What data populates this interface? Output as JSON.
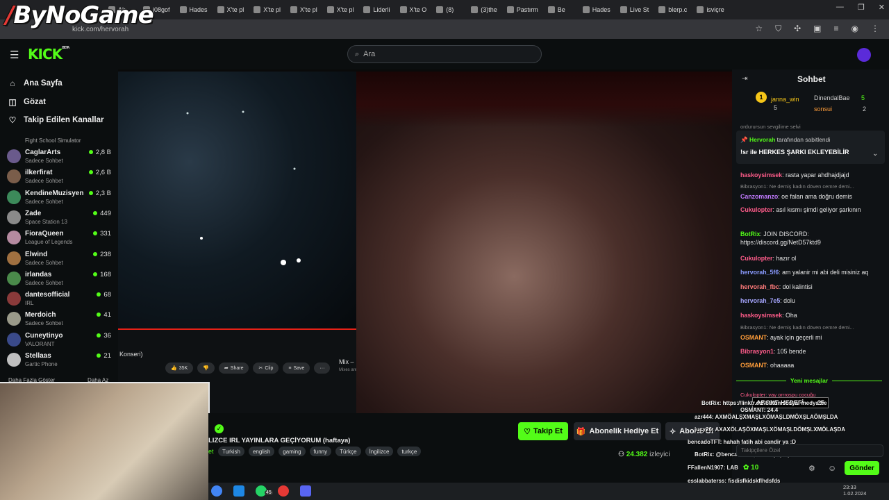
{
  "browser": {
    "tabs": [
      "Ak",
      "j08gof",
      "Hades",
      "X'te pl",
      "X'te pl",
      "X'te pl",
      "X'te pl",
      "Liderli",
      "X'te O",
      "(8)",
      "(3)the",
      "Pastırm",
      "Be",
      "Hades",
      "Live St",
      "blerp.c",
      "isviçre"
    ],
    "tab_prefix": "X'te O",
    "url": "kick.com/hervorah"
  },
  "watermark": {
    "slash": "/",
    "text": "ByNoGame"
  },
  "kick": {
    "logo": "KICK",
    "logo_sup": "BETA",
    "search_placeholder": "Ara"
  },
  "sidebar": {
    "nav": [
      {
        "label": "Ana Sayfa",
        "icon": "home-icon",
        "glyph": "⌂"
      },
      {
        "label": "Gözat",
        "icon": "browse-icon",
        "glyph": "◫"
      },
      {
        "label": "Takip Edilen Kanallar",
        "icon": "heart-icon",
        "glyph": "♡"
      }
    ],
    "partial_category": "Fight School Simulator",
    "channels": [
      {
        "name": "CaglarArts",
        "category": "Sadece Sohbet",
        "viewers": "2,8 B",
        "color": "#6a5a8c"
      },
      {
        "name": "ilkerfirat",
        "category": "Sadece Sohbet",
        "viewers": "2,6 B",
        "color": "#7a5d4a"
      },
      {
        "name": "KendineMuzisyen",
        "category": "Sadece Sohbet",
        "viewers": "2,3 B",
        "color": "#3c8a5a"
      },
      {
        "name": "Zade",
        "category": "Space Station 13",
        "viewers": "449",
        "color": "#8a8a8a"
      },
      {
        "name": "FioraQueen",
        "category": "League of Legends",
        "viewers": "331",
        "color": "#b58aa0"
      },
      {
        "name": "Elwind",
        "category": "Sadece Sohbet",
        "viewers": "238",
        "color": "#a07040"
      },
      {
        "name": "irlandas",
        "category": "Sadece Sohbet",
        "viewers": "168",
        "color": "#4a8a4a"
      },
      {
        "name": "dantesofficial",
        "category": "IRL",
        "viewers": "68",
        "color": "#8a3a3a"
      },
      {
        "name": "Merdoich",
        "category": "Sadece Sohbet",
        "viewers": "41",
        "color": "#9a9a8a"
      },
      {
        "name": "Cuneytinyo",
        "category": "VALORANT",
        "viewers": "36",
        "color": "#3a4a8a"
      },
      {
        "name": "Stellaas",
        "category": "Gartic Phone",
        "viewers": "21",
        "color": "#c0c0c0"
      }
    ],
    "show_more": "Daha Fazla Göster",
    "show_less": "Daha Az"
  },
  "video": {
    "yt_title_fragment": "Konseri)",
    "yt_actions": [
      "35K",
      "",
      "Share",
      "Clip",
      "Save",
      "···"
    ],
    "mix_label": "Mix –",
    "mix_sub": "Mixes are"
  },
  "channel": {
    "stream_title": "LIZCE IRL YAYINLARA GEÇİYORUM (haftaya)",
    "lang_fragment": "et",
    "tags": [
      "Turkish",
      "english",
      "gaming",
      "funny",
      "Türkçe",
      "İngilizce",
      "turkçe"
    ],
    "follow_label": "Takip Et",
    "gift_label": "Abonelik Hediye Et",
    "subscribe_label": "Abone Ol",
    "viewers": "24.382",
    "viewers_label": "izleyici"
  },
  "chat": {
    "title": "Sohbet",
    "leaderboard": [
      {
        "rank": "1",
        "name": "janna_win",
        "count": "5"
      },
      {
        "name": "DinendalBae",
        "count": "5"
      },
      {
        "name": "sonsui",
        "count": "2"
      }
    ],
    "partial_line": "ordurursun sevgilime selvi",
    "pinned_by_user": "Hervorah",
    "pinned_by_text": "tarafından sabitlendi",
    "pinned_text": "!sr ile HERKES ŞARKI EKLEYEBİLİR",
    "messages": [
      {
        "user": "haskoysimsek",
        "text": ": rasta yapar ahdhajdjajd",
        "color": "#ff5c8a"
      },
      {
        "reply": "Bibrasyon1: Ne demiş kadın döven cemre demi..."
      },
      {
        "user": "Canzomanzo",
        "text": ": oe falan ama doğru demis",
        "color": "#c17bff"
      },
      {
        "user": "Cukulopter",
        "text": ": asıl kısmı şimdi geliyor şarkının",
        "color": "#ff5c8a"
      },
      {
        "user": "BotRix",
        "text": ": JOIN DISCORD: https://discord.gg/NetD57ktd9",
        "color": "#53fc18"
      },
      {
        "user": "Cukulopter",
        "text": ": hazır ol",
        "color": "#ff5c8a"
      },
      {
        "user": "hervorah_5f6",
        "text": ": am yalanir mi abi deli misiniz aq",
        "color": "#8a9bff"
      },
      {
        "user": "hervorah_fbc",
        "text": ": dol kalintisi",
        "color": "#ff7b7b"
      },
      {
        "user": "hervorah_7e5",
        "text": ": dolu",
        "color": "#a6a6ff"
      },
      {
        "user": "haskoysimsek",
        "text": ": Oha",
        "color": "#ff5c8a"
      },
      {
        "reply": "Bibrasyon1: Ne demiş kadın döven cemre demi..."
      },
      {
        "user": "OSMANT",
        "text": ": ayak için geçerli mi",
        "color": "#ff9d3a"
      },
      {
        "user": "Bibrasyon1",
        "text": ": 105 bende",
        "color": "#ff5c8a"
      },
      {
        "user": "OSMANT",
        "text": ": ohaaaaa",
        "color": "#ff9d3a"
      }
    ],
    "new_messages": "Yeni mesajlar",
    "partial_after": "Cukulopter: vay orrrospu cocuğu",
    "input_placeholder": "Takipçilere Özel",
    "points": "10",
    "send_label": "Gönder"
  },
  "overlay": {
    "goal_label": "ABONE HEDEFİ",
    "goal_value": "25",
    "lines": [
      "BotRix: https://linktr.ee/ bütün sosyal medya he",
      "OSMANT: 24.4",
      "azr444: AXMÖALŞXMAŞLXÖMAŞLDMÖXŞLAÖMŞLDA",
      "jucy26: AXAXÖLAŞÖXMAŞLXÖMAŞLDÖMŞLXMÖLAŞDA",
      "bencadoTFT: hahah fatih abi candir ya :D",
      "BotRix: @bencadoTFT, 2. seviyeye yükseldin",
      "FFallenN1907: LAB",
      "esslabbaterss: fjsdjsfkjdskflhdsfds",
      "BotRix: Donate, Blerp, Abonelik, Hediye Abonelikler Yüksek sesle okunma"
    ]
  },
  "taskbar": {
    "badge": "45",
    "time": "23:33",
    "date": "1.02.2024"
  }
}
